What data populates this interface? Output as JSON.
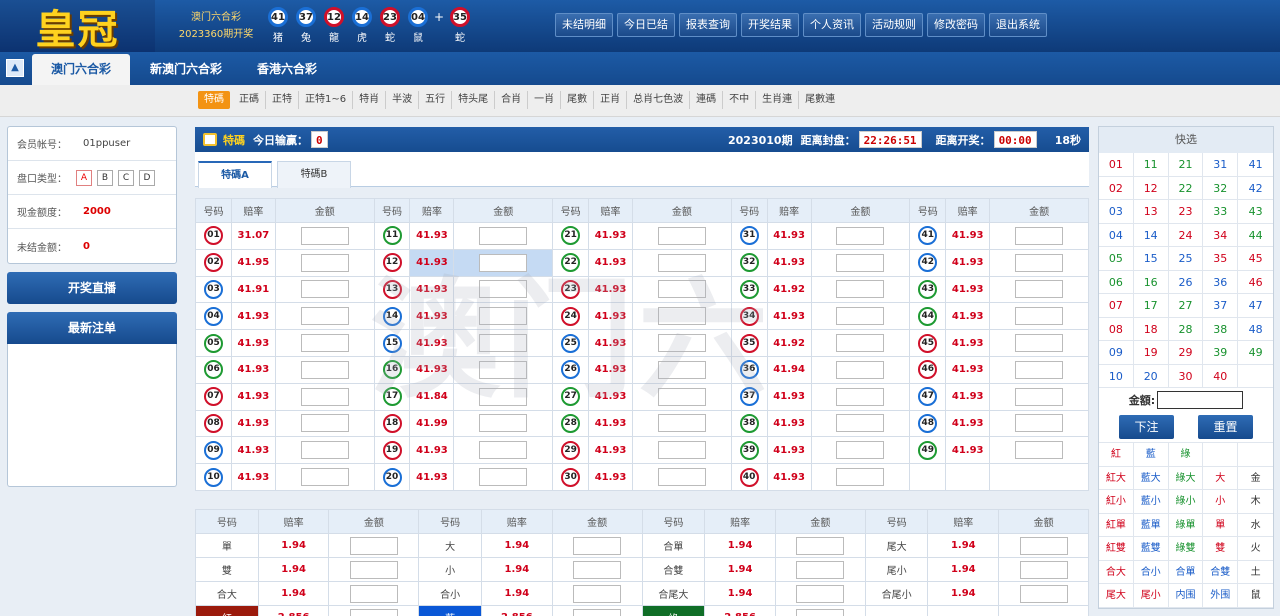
{
  "logo": "皇冠",
  "draw": {
    "game": "澳门六合彩",
    "period": "2023360期开奖"
  },
  "result_balls": [
    {
      "num": "41",
      "zodiac": "猪",
      "color": "#1a6fd6"
    },
    {
      "num": "37",
      "zodiac": "兔",
      "color": "#1a6fd6"
    },
    {
      "num": "12",
      "zodiac": "龍",
      "color": "#d0102a"
    },
    {
      "num": "14",
      "zodiac": "虎",
      "color": "#1a6fd6"
    },
    {
      "num": "23",
      "zodiac": "蛇",
      "color": "#d0102a"
    },
    {
      "num": "04",
      "zodiac": "鼠",
      "color": "#1a6fd6"
    }
  ],
  "plus": "+",
  "special_ball": {
    "num": "35",
    "zodiac": "蛇",
    "color": "#d0102a"
  },
  "top_nav": [
    "未结明细",
    "今日已结",
    "报表查询",
    "开奖结果",
    "个人资讯",
    "活动规则",
    "修改密码",
    "退出系统"
  ],
  "game_tabs": [
    "澳门六合彩",
    "新澳门六合彩",
    "香港六合彩"
  ],
  "up_icon": "▲",
  "sub_nav": [
    "特碼",
    "正碼",
    "正特",
    "正特1~6",
    "特肖",
    "半波",
    "五行",
    "特头尾",
    "合肖",
    "一肖",
    "尾數",
    "正肖",
    "总肖七色波",
    "連碼",
    "不中",
    "生肖連",
    "尾數連"
  ],
  "account": {
    "member_label": "会员帐号：",
    "member_value": "01ppuser",
    "pankou_label": "盘口类型：",
    "pankou_options": [
      "A",
      "B",
      "C",
      "D"
    ],
    "credit_label": "现金额度：",
    "credit_value": "2000",
    "unsettled_label": "未结金额：",
    "unsettled_value": "0"
  },
  "live_button": "开奖直播",
  "latest_orders": "最新注单",
  "main_header": {
    "title": "特碼",
    "today_label": "今日输赢：",
    "today_value": "0",
    "period": "2023010期",
    "close_label": "距离封盘：",
    "close_time": "22:26:51",
    "open_label": "距离开奖：",
    "open_time": "00:00",
    "seconds": "18秒"
  },
  "bet_tabs": [
    "特碼A",
    "特碼B"
  ],
  "grid_headers": {
    "num": "号码",
    "odds": "赔率",
    "amount": "金额"
  },
  "numbers": [
    {
      "n": "01",
      "o": "31.07",
      "c": "r"
    },
    {
      "n": "02",
      "o": "41.95",
      "c": "r"
    },
    {
      "n": "03",
      "o": "41.91",
      "c": "u"
    },
    {
      "n": "04",
      "o": "41.93",
      "c": "u"
    },
    {
      "n": "05",
      "o": "41.93",
      "c": "g"
    },
    {
      "n": "06",
      "o": "41.93",
      "c": "g"
    },
    {
      "n": "07",
      "o": "41.93",
      "c": "r"
    },
    {
      "n": "08",
      "o": "41.93",
      "c": "r"
    },
    {
      "n": "09",
      "o": "41.93",
      "c": "u"
    },
    {
      "n": "10",
      "o": "41.93",
      "c": "u"
    },
    {
      "n": "11",
      "o": "41.93",
      "c": "g"
    },
    {
      "n": "12",
      "o": "41.93",
      "c": "r"
    },
    {
      "n": "13",
      "o": "41.93",
      "c": "r"
    },
    {
      "n": "14",
      "o": "41.93",
      "c": "u"
    },
    {
      "n": "15",
      "o": "41.93",
      "c": "u"
    },
    {
      "n": "16",
      "o": "41.93",
      "c": "g"
    },
    {
      "n": "17",
      "o": "41.84",
      "c": "g"
    },
    {
      "n": "18",
      "o": "41.99",
      "c": "r"
    },
    {
      "n": "19",
      "o": "41.93",
      "c": "r"
    },
    {
      "n": "20",
      "o": "41.93",
      "c": "u"
    },
    {
      "n": "21",
      "o": "41.93",
      "c": "g"
    },
    {
      "n": "22",
      "o": "41.93",
      "c": "g"
    },
    {
      "n": "23",
      "o": "41.93",
      "c": "r"
    },
    {
      "n": "24",
      "o": "41.93",
      "c": "r"
    },
    {
      "n": "25",
      "o": "41.93",
      "c": "u"
    },
    {
      "n": "26",
      "o": "41.93",
      "c": "u"
    },
    {
      "n": "27",
      "o": "41.93",
      "c": "g"
    },
    {
      "n": "28",
      "o": "41.93",
      "c": "g"
    },
    {
      "n": "29",
      "o": "41.93",
      "c": "r"
    },
    {
      "n": "30",
      "o": "41.93",
      "c": "r"
    },
    {
      "n": "31",
      "o": "41.93",
      "c": "u"
    },
    {
      "n": "32",
      "o": "41.93",
      "c": "g"
    },
    {
      "n": "33",
      "o": "41.92",
      "c": "g"
    },
    {
      "n": "34",
      "o": "41.93",
      "c": "r"
    },
    {
      "n": "35",
      "o": "41.92",
      "c": "r"
    },
    {
      "n": "36",
      "o": "41.94",
      "c": "u"
    },
    {
      "n": "37",
      "o": "41.93",
      "c": "u"
    },
    {
      "n": "38",
      "o": "41.93",
      "c": "g"
    },
    {
      "n": "39",
      "o": "41.93",
      "c": "g"
    },
    {
      "n": "40",
      "o": "41.93",
      "c": "r"
    },
    {
      "n": "41",
      "o": "41.93",
      "c": "u"
    },
    {
      "n": "42",
      "o": "41.93",
      "c": "u"
    },
    {
      "n": "43",
      "o": "41.93",
      "c": "g"
    },
    {
      "n": "44",
      "o": "41.93",
      "c": "g"
    },
    {
      "n": "45",
      "o": "41.93",
      "c": "r"
    },
    {
      "n": "46",
      "o": "41.93",
      "c": "r"
    },
    {
      "n": "47",
      "o": "41.93",
      "c": "u"
    },
    {
      "n": "48",
      "o": "41.93",
      "c": "u"
    },
    {
      "n": "49",
      "o": "41.93",
      "c": "g"
    }
  ],
  "attrs": {
    "headers": [
      "号码",
      "赔率",
      "金额"
    ],
    "rows": [
      [
        {
          "l": "單",
          "o": "1.94"
        },
        {
          "l": "大",
          "o": "1.94"
        },
        {
          "l": "合單",
          "o": "1.94"
        },
        {
          "l": "尾大",
          "o": "1.94"
        }
      ],
      [
        {
          "l": "雙",
          "o": "1.94"
        },
        {
          "l": "小",
          "o": "1.94"
        },
        {
          "l": "合雙",
          "o": "1.94"
        },
        {
          "l": "尾小",
          "o": "1.94"
        }
      ],
      [
        {
          "l": "合大",
          "o": "1.94"
        },
        {
          "l": "合小",
          "o": "1.94"
        },
        {
          "l": "合尾大",
          "o": "1.94"
        },
        {
          "l": "合尾小",
          "o": "1.94"
        }
      ],
      [
        {
          "l": "紅",
          "o": "2.856"
        },
        {
          "l": "藍",
          "o": "2.856"
        },
        {
          "l": "綠",
          "o": "2.856"
        },
        {
          "l": "",
          "o": ""
        }
      ]
    ]
  },
  "quick": {
    "title": "快选",
    "numbers": [
      "01",
      "11",
      "21",
      "31",
      "41",
      "02",
      "12",
      "22",
      "32",
      "42",
      "03",
      "13",
      "23",
      "33",
      "43",
      "04",
      "14",
      "24",
      "34",
      "44",
      "05",
      "15",
      "25",
      "35",
      "45",
      "06",
      "16",
      "26",
      "36",
      "46",
      "07",
      "17",
      "27",
      "37",
      "47",
      "08",
      "18",
      "28",
      "38",
      "48",
      "09",
      "19",
      "29",
      "39",
      "49",
      "10",
      "20",
      "30",
      "40",
      ""
    ],
    "amount_label": "金額:",
    "bet_btn": "下注",
    "reset_btn": "重置",
    "cats": [
      {
        "t": "紅",
        "c": "r"
      },
      {
        "t": "藍",
        "c": "b"
      },
      {
        "t": "綠",
        "c": "g"
      },
      {
        "t": "",
        "c": "k"
      },
      {
        "t": "",
        "c": "k"
      },
      {
        "t": "紅大",
        "c": "r"
      },
      {
        "t": "藍大",
        "c": "b"
      },
      {
        "t": "綠大",
        "c": "g"
      },
      {
        "t": "大",
        "c": "r"
      },
      {
        "t": "金",
        "c": "k"
      },
      {
        "t": "紅小",
        "c": "r"
      },
      {
        "t": "藍小",
        "c": "b"
      },
      {
        "t": "綠小",
        "c": "g"
      },
      {
        "t": "小",
        "c": "r"
      },
      {
        "t": "木",
        "c": "k"
      },
      {
        "t": "紅單",
        "c": "r"
      },
      {
        "t": "藍單",
        "c": "b"
      },
      {
        "t": "綠單",
        "c": "g"
      },
      {
        "t": "單",
        "c": "r"
      },
      {
        "t": "水",
        "c": "k"
      },
      {
        "t": "紅雙",
        "c": "r"
      },
      {
        "t": "藍雙",
        "c": "b"
      },
      {
        "t": "綠雙",
        "c": "g"
      },
      {
        "t": "雙",
        "c": "r"
      },
      {
        "t": "火",
        "c": "k"
      },
      {
        "t": "合大",
        "c": "r"
      },
      {
        "t": "合小",
        "c": "b"
      },
      {
        "t": "合單",
        "c": "b"
      },
      {
        "t": "合雙",
        "c": "b"
      },
      {
        "t": "土",
        "c": "k"
      },
      {
        "t": "尾大",
        "c": "r"
      },
      {
        "t": "尾小",
        "c": "r"
      },
      {
        "t": "内围",
        "c": "b"
      },
      {
        "t": "外围",
        "c": "b"
      },
      {
        "t": "鼠",
        "c": "k"
      }
    ]
  },
  "watermark": "澳门六"
}
